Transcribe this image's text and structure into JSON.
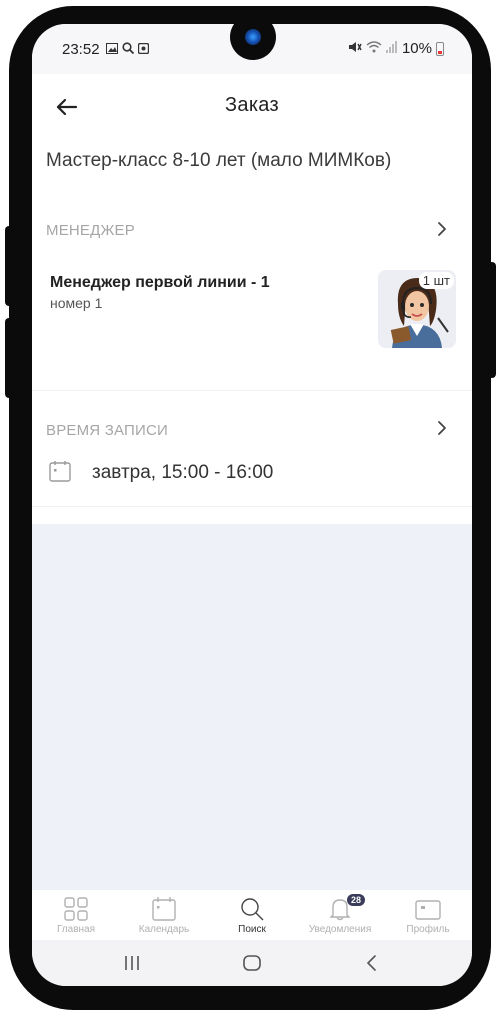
{
  "status_bar": {
    "time": "23:52",
    "battery": "10%",
    "icons": [
      "image-icon",
      "search-icon",
      "camera-icon",
      "mute-icon",
      "wifi-icon",
      "signal-icon",
      "battery-icon"
    ]
  },
  "header": {
    "title": "Заказ",
    "back_icon": "arrow-left-icon"
  },
  "order": {
    "title": "Мастер-класс 8-10 лет (мало МИМКов)"
  },
  "manager_section": {
    "label": "МЕНЕДЖЕР",
    "name": "Менеджер первой линии - 1",
    "subtitle": "номер 1",
    "quantity_badge": "1 шт"
  },
  "time_section": {
    "label": "ВРЕМЯ ЗАПИСИ",
    "value": "завтра, 15:00 - 16:00"
  },
  "bottom_nav": {
    "items": [
      {
        "label": "Главная",
        "icon": "grid-icon",
        "active": false
      },
      {
        "label": "Календарь",
        "icon": "calendar-icon",
        "active": false
      },
      {
        "label": "Поиск",
        "icon": "search-icon",
        "active": true
      },
      {
        "label": "Уведомления",
        "icon": "bell-icon",
        "active": false,
        "badge": "28"
      },
      {
        "label": "Профиль",
        "icon": "profile-icon",
        "active": false
      }
    ]
  },
  "colors": {
    "background": "#eef1f8",
    "card": "#ffffff",
    "section_label": "#a6a6a6",
    "badge": "#3b3b5a"
  }
}
